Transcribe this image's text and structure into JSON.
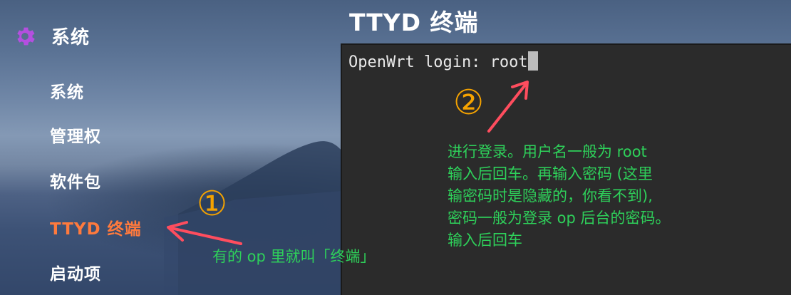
{
  "sidebar": {
    "section_title": "系统",
    "items": [
      {
        "label": "系统"
      },
      {
        "label": "管理权"
      },
      {
        "label": "软件包"
      },
      {
        "label": "TTYD 终端"
      },
      {
        "label": "启动项"
      }
    ],
    "active_index": 3
  },
  "page": {
    "title": "TTYD 终端"
  },
  "terminal": {
    "prompt": "OpenWrt login: root"
  },
  "annotations": {
    "marker_1": "①",
    "marker_2": "②",
    "note_1": "有的 op 里就叫「终端」",
    "note_2_lines": [
      "进行登录。用户名一般为 root",
      "输入后回车。再输入密码 (这里",
      "输密码时是隐藏的，你看不到),",
      "密码一般为登录 op 后台的密码。",
      "输入后回车"
    ]
  },
  "colors": {
    "active_nav": "#ff7a3d",
    "gear": "#b44fe0",
    "terminal_bg": "#2b2b2b",
    "annotation_number": "#f5a300",
    "annotation_text": "#2ed05a",
    "arrow": "#ff4d5e"
  },
  "icons": {
    "section": "gear-icon"
  }
}
